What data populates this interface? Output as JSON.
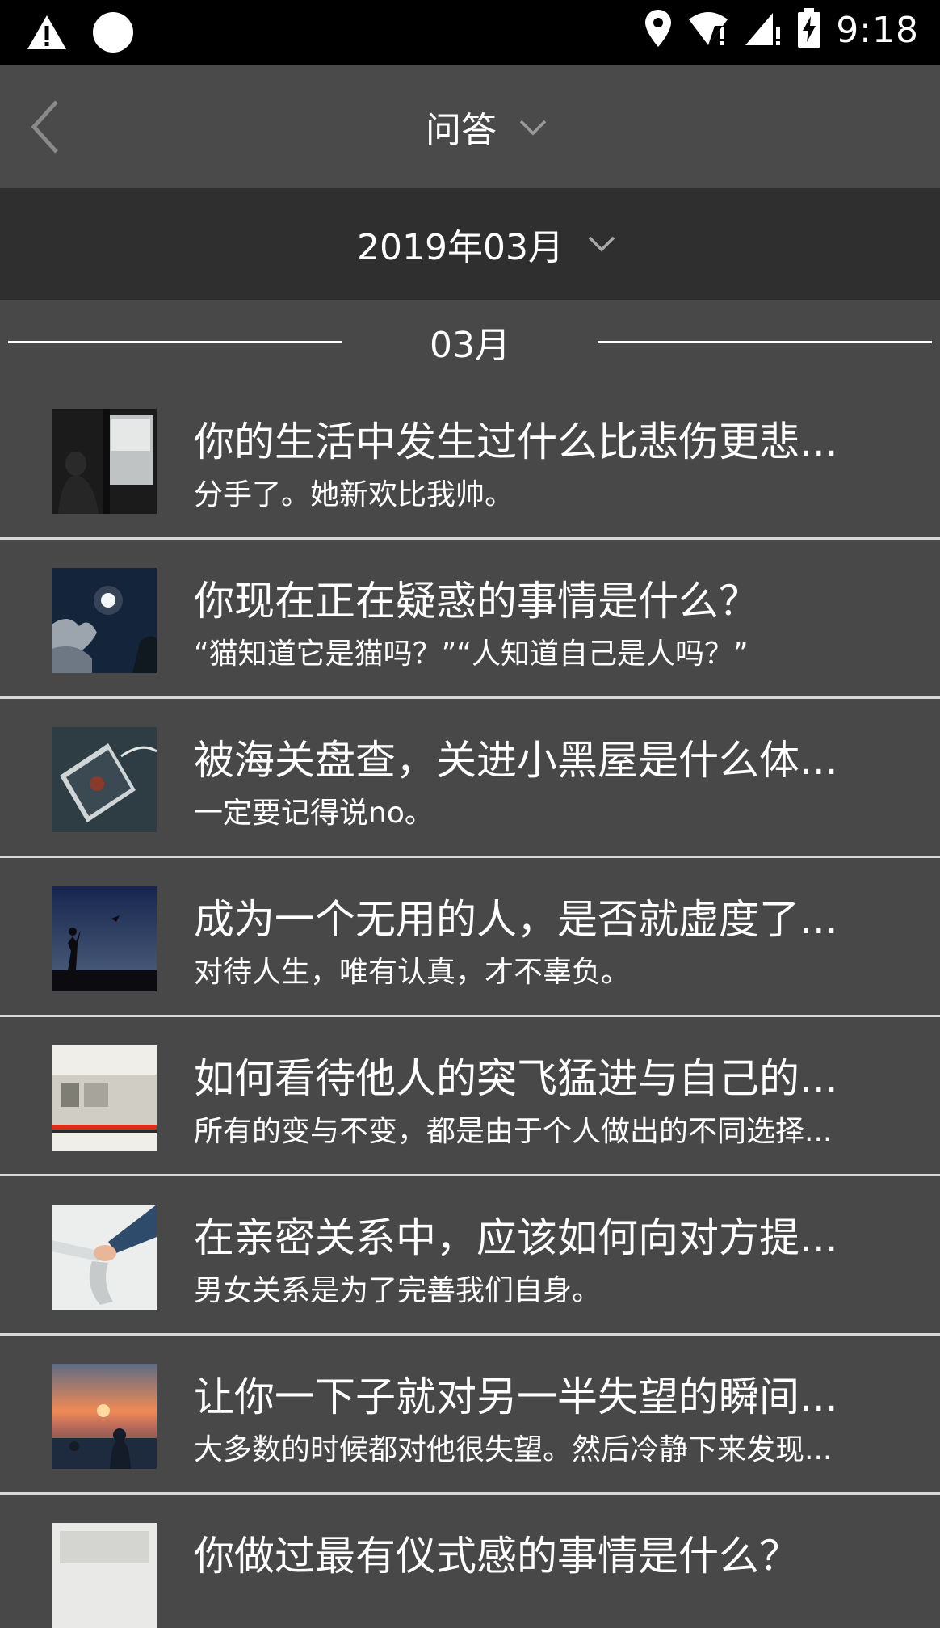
{
  "status_bar": {
    "time": "9:18",
    "icons": [
      "warning-icon",
      "circle-icon",
      "location-icon",
      "wifi-alert-icon",
      "signal-alert-icon",
      "battery-charging-icon"
    ]
  },
  "header": {
    "back_icon": "chevron-left-icon",
    "title": "问答",
    "title_dropdown_icon": "chevron-down-icon"
  },
  "month_selector": {
    "label": "2019年03月",
    "dropdown_icon": "chevron-down-icon"
  },
  "section": {
    "label": "03月"
  },
  "items": [
    {
      "title": "你的生活中发生过什么比悲伤更悲...",
      "subtitle": "分手了。她新欢比我帅。"
    },
    {
      "title": "你现在正在疑惑的事情是什么？",
      "subtitle": "“猫知道它是猫吗？”“人知道自己是人吗？”"
    },
    {
      "title": "被海关盘查，关进小黑屋是什么体...",
      "subtitle": "一定要记得说no。"
    },
    {
      "title": "成为一个无用的人，是否就虚度了...",
      "subtitle": "对待人生，唯有认真，才不辜负。"
    },
    {
      "title": "如何看待他人的突飞猛进与自己的...",
      "subtitle": "所有的变与不变，都是由于个人做出的不同选择..."
    },
    {
      "title": "在亲密关系中，应该如何向对方提...",
      "subtitle": "男女关系是为了完善我们自身。"
    },
    {
      "title": "让你一下子就对另一半失望的瞬间...",
      "subtitle": "大多数的时候都对他很失望。然后冷静下来发现..."
    },
    {
      "title": "你做过最有仪式感的事情是什么？",
      "subtitle": ""
    }
  ]
}
